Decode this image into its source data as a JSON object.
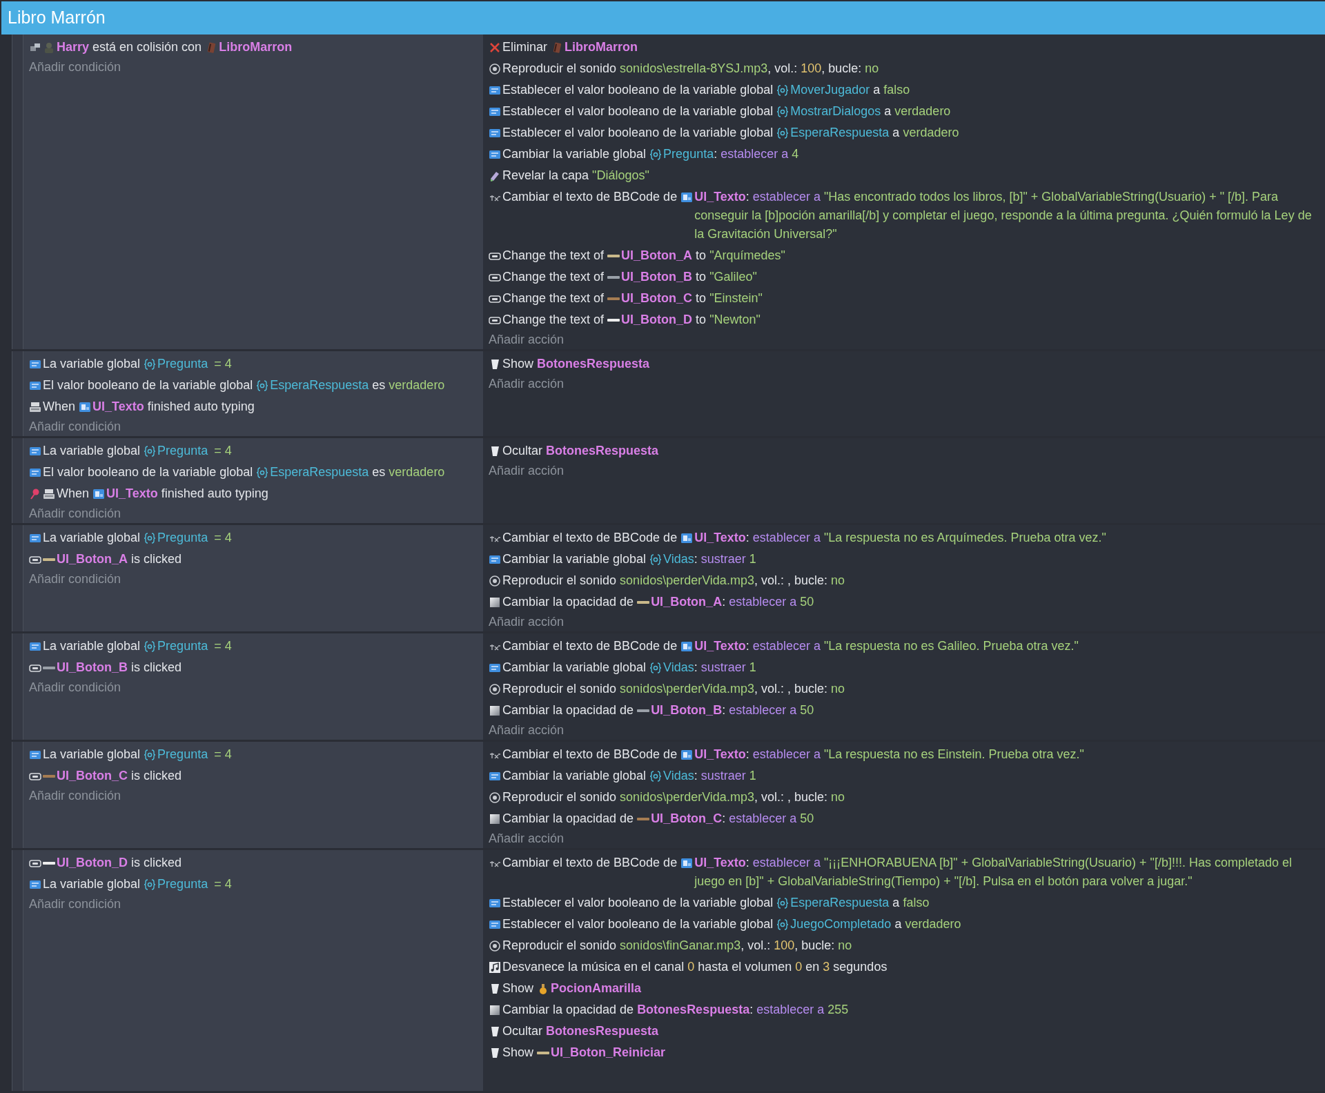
{
  "window": {
    "title": "Libro Marrón"
  },
  "events": [
    {
      "conditions": [
        {
          "parts": [
            {
              "kind": "collision"
            },
            {
              "kind": "character"
            },
            {
              "kind": "object",
              "text": "Harry"
            },
            {
              "kind": "plain",
              "text": " está en colisión con "
            },
            {
              "kind": "book"
            },
            {
              "kind": "object",
              "text": "LibroMarron"
            }
          ]
        }
      ],
      "add_condition": "Añadir condición",
      "actions": [
        {
          "parts": [
            {
              "kind": "delete"
            },
            {
              "kind": "plain",
              "text": "Eliminar "
            },
            {
              "kind": "book"
            },
            {
              "kind": "object",
              "text": "LibroMarron"
            }
          ]
        },
        {
          "parts": [
            {
              "kind": "sound"
            },
            {
              "kind": "plain",
              "text": "Reproducir el sonido "
            },
            {
              "kind": "value",
              "text": "sonidos\\estrella-8YSJ.mp3"
            },
            {
              "kind": "plain",
              "text": ", vol.: "
            },
            {
              "kind": "number",
              "text": "100"
            },
            {
              "kind": "plain",
              "text": ", bucle: "
            },
            {
              "kind": "value",
              "text": "no"
            }
          ]
        },
        {
          "parts": [
            {
              "kind": "variable"
            },
            {
              "kind": "plain",
              "text": "Establecer el valor booleano de la variable global "
            },
            {
              "kind": "globalvar"
            },
            {
              "kind": "varname",
              "text": "MoverJugador"
            },
            {
              "kind": "plain",
              "text": " a "
            },
            {
              "kind": "value",
              "text": "falso"
            }
          ]
        },
        {
          "parts": [
            {
              "kind": "variable"
            },
            {
              "kind": "plain",
              "text": "Establecer el valor booleano de la variable global "
            },
            {
              "kind": "globalvar"
            },
            {
              "kind": "varname",
              "text": "MostrarDialogos"
            },
            {
              "kind": "plain",
              "text": " a "
            },
            {
              "kind": "value",
              "text": "verdadero"
            }
          ]
        },
        {
          "parts": [
            {
              "kind": "variable"
            },
            {
              "kind": "plain",
              "text": "Establecer el valor booleano de la variable global "
            },
            {
              "kind": "globalvar"
            },
            {
              "kind": "varname",
              "text": "EsperaRespuesta"
            },
            {
              "kind": "plain",
              "text": " a "
            },
            {
              "kind": "value",
              "text": "verdadero"
            }
          ]
        },
        {
          "parts": [
            {
              "kind": "variable"
            },
            {
              "kind": "plain",
              "text": "Cambiar la variable global "
            },
            {
              "kind": "globalvar"
            },
            {
              "kind": "varname",
              "text": "Pregunta"
            },
            {
              "kind": "plain",
              "text": ": "
            },
            {
              "kind": "operator",
              "text": "establecer a"
            },
            {
              "kind": "value",
              "text": "4"
            }
          ]
        },
        {
          "parts": [
            {
              "kind": "layer"
            },
            {
              "kind": "plain",
              "text": "Revelar la capa "
            },
            {
              "kind": "value",
              "text": "\"Diálogos\""
            }
          ]
        },
        {
          "parts": [
            {
              "kind": "text"
            },
            {
              "kind": "plain",
              "text": "Cambiar el texto de BBCode de "
            },
            {
              "kind": "bbtext"
            },
            {
              "kind": "object",
              "text": "UI_Texto"
            },
            {
              "kind": "plain",
              "text": ": "
            },
            {
              "kind": "operator",
              "text": "establecer a"
            },
            {
              "kind": "value",
              "text": "\"Has encontrado todos los libros, [b]\" + GlobalVariableString(Usuario) + \" [/b]. Para conseguir la [b]poción amarilla[/b] y completar el juego, responde a la última pregunta. ¿Quién formuló la Ley de la Gravitación Universal?\""
            }
          ]
        },
        {
          "parts": [
            {
              "kind": "button"
            },
            {
              "kind": "plain",
              "text": "Change the text of "
            },
            {
              "kind": "bar",
              "color": "#c9b88a"
            },
            {
              "kind": "object",
              "text": "UI_Boton_A"
            },
            {
              "kind": "plain",
              "text": " to "
            },
            {
              "kind": "value",
              "text": "\"Arquímedes\""
            }
          ]
        },
        {
          "parts": [
            {
              "kind": "button"
            },
            {
              "kind": "plain",
              "text": "Change the text of "
            },
            {
              "kind": "bar",
              "color": "#9aa0a8"
            },
            {
              "kind": "object",
              "text": "UI_Boton_B"
            },
            {
              "kind": "plain",
              "text": " to "
            },
            {
              "kind": "value",
              "text": "\"Galileo\""
            }
          ]
        },
        {
          "parts": [
            {
              "kind": "button"
            },
            {
              "kind": "plain",
              "text": "Change the text of "
            },
            {
              "kind": "bar",
              "color": "#a57c52"
            },
            {
              "kind": "object",
              "text": "UI_Boton_C"
            },
            {
              "kind": "plain",
              "text": " to "
            },
            {
              "kind": "value",
              "text": "\"Einstein\""
            }
          ]
        },
        {
          "parts": [
            {
              "kind": "button"
            },
            {
              "kind": "plain",
              "text": "Change the text of "
            },
            {
              "kind": "bar",
              "color": "#ececec"
            },
            {
              "kind": "object",
              "text": "UI_Boton_D"
            },
            {
              "kind": "plain",
              "text": " to "
            },
            {
              "kind": "value",
              "text": "\"Newton\""
            }
          ]
        }
      ],
      "add_action": "Añadir acción"
    },
    {
      "conditions": [
        {
          "parts": [
            {
              "kind": "variable"
            },
            {
              "kind": "plain",
              "text": "La variable global "
            },
            {
              "kind": "globalvar"
            },
            {
              "kind": "varname",
              "text": "Pregunta"
            },
            {
              "kind": "value",
              "text": "= 4"
            }
          ]
        },
        {
          "parts": [
            {
              "kind": "variable"
            },
            {
              "kind": "plain",
              "text": "El valor booleano de la variable global "
            },
            {
              "kind": "globalvar"
            },
            {
              "kind": "varname",
              "text": "EsperaRespuesta"
            },
            {
              "kind": "plain",
              "text": " es "
            },
            {
              "kind": "value",
              "text": "verdadero"
            }
          ]
        },
        {
          "parts": [
            {
              "kind": "typing"
            },
            {
              "kind": "plain",
              "text": "When "
            },
            {
              "kind": "bbtext"
            },
            {
              "kind": "object",
              "text": "UI_Texto"
            },
            {
              "kind": "plain",
              "text": " finished auto typing"
            }
          ]
        }
      ],
      "add_condition": "Añadir condición",
      "actions": [
        {
          "parts": [
            {
              "kind": "show"
            },
            {
              "kind": "plain",
              "text": "Show "
            },
            {
              "kind": "object",
              "text": "BotonesRespuesta"
            }
          ]
        }
      ],
      "add_action": "Añadir acción"
    },
    {
      "conditions": [
        {
          "parts": [
            {
              "kind": "variable"
            },
            {
              "kind": "plain",
              "text": "La variable global "
            },
            {
              "kind": "globalvar"
            },
            {
              "kind": "varname",
              "text": "Pregunta"
            },
            {
              "kind": "value",
              "text": "= 4"
            }
          ]
        },
        {
          "parts": [
            {
              "kind": "variable"
            },
            {
              "kind": "plain",
              "text": "El valor booleano de la variable global "
            },
            {
              "kind": "globalvar"
            },
            {
              "kind": "varname",
              "text": "EsperaRespuesta"
            },
            {
              "kind": "plain",
              "text": " es "
            },
            {
              "kind": "value",
              "text": "verdadero"
            }
          ]
        },
        {
          "parts": [
            {
              "kind": "pin"
            },
            {
              "kind": "typing"
            },
            {
              "kind": "plain",
              "text": "When "
            },
            {
              "kind": "bbtext"
            },
            {
              "kind": "object",
              "text": "UI_Texto"
            },
            {
              "kind": "plain",
              "text": " finished auto typing"
            }
          ]
        }
      ],
      "add_condition": "Añadir condición",
      "actions": [
        {
          "parts": [
            {
              "kind": "show"
            },
            {
              "kind": "plain",
              "text": "Ocultar "
            },
            {
              "kind": "object",
              "text": "BotonesRespuesta"
            }
          ]
        }
      ],
      "add_action": "Añadir acción"
    },
    {
      "conditions": [
        {
          "parts": [
            {
              "kind": "variable"
            },
            {
              "kind": "plain",
              "text": "La variable global "
            },
            {
              "kind": "globalvar"
            },
            {
              "kind": "varname",
              "text": "Pregunta"
            },
            {
              "kind": "value",
              "text": "= 4"
            }
          ]
        },
        {
          "parts": [
            {
              "kind": "button"
            },
            {
              "kind": "bar",
              "color": "#c9b88a"
            },
            {
              "kind": "object",
              "text": "UI_Boton_A"
            },
            {
              "kind": "plain",
              "text": " is clicked"
            }
          ]
        }
      ],
      "add_condition": "Añadir condición",
      "actions": [
        {
          "parts": [
            {
              "kind": "text"
            },
            {
              "kind": "plain",
              "text": "Cambiar el texto de BBCode de "
            },
            {
              "kind": "bbtext"
            },
            {
              "kind": "object",
              "text": "UI_Texto"
            },
            {
              "kind": "plain",
              "text": ": "
            },
            {
              "kind": "operator",
              "text": "establecer a"
            },
            {
              "kind": "value",
              "text": "\"La respuesta no es Arquímedes. Prueba otra vez.\""
            }
          ]
        },
        {
          "parts": [
            {
              "kind": "variable"
            },
            {
              "kind": "plain",
              "text": "Cambiar la variable global "
            },
            {
              "kind": "globalvar"
            },
            {
              "kind": "varname",
              "text": "Vidas"
            },
            {
              "kind": "plain",
              "text": ": "
            },
            {
              "kind": "operator",
              "text": "sustraer"
            },
            {
              "kind": "value",
              "text": "1"
            }
          ]
        },
        {
          "parts": [
            {
              "kind": "sound"
            },
            {
              "kind": "plain",
              "text": "Reproducir el sonido "
            },
            {
              "kind": "value",
              "text": "sonidos\\perderVida.mp3"
            },
            {
              "kind": "plain",
              "text": ", vol.: , bucle: "
            },
            {
              "kind": "value",
              "text": "no"
            }
          ]
        },
        {
          "parts": [
            {
              "kind": "opacity"
            },
            {
              "kind": "plain",
              "text": "Cambiar la opacidad de "
            },
            {
              "kind": "bar",
              "color": "#c9b88a"
            },
            {
              "kind": "object",
              "text": "UI_Boton_A"
            },
            {
              "kind": "plain",
              "text": ": "
            },
            {
              "kind": "operator",
              "text": "establecer a"
            },
            {
              "kind": "value",
              "text": "50"
            }
          ]
        }
      ],
      "add_action": "Añadir acción"
    },
    {
      "conditions": [
        {
          "parts": [
            {
              "kind": "variable"
            },
            {
              "kind": "plain",
              "text": "La variable global "
            },
            {
              "kind": "globalvar"
            },
            {
              "kind": "varname",
              "text": "Pregunta"
            },
            {
              "kind": "value",
              "text": "= 4"
            }
          ]
        },
        {
          "parts": [
            {
              "kind": "button"
            },
            {
              "kind": "bar",
              "color": "#9aa0a8"
            },
            {
              "kind": "object",
              "text": "UI_Boton_B"
            },
            {
              "kind": "plain",
              "text": " is clicked"
            }
          ]
        }
      ],
      "add_condition": "Añadir condición",
      "actions": [
        {
          "parts": [
            {
              "kind": "text"
            },
            {
              "kind": "plain",
              "text": "Cambiar el texto de BBCode de "
            },
            {
              "kind": "bbtext"
            },
            {
              "kind": "object",
              "text": "UI_Texto"
            },
            {
              "kind": "plain",
              "text": ": "
            },
            {
              "kind": "operator",
              "text": "establecer a"
            },
            {
              "kind": "value",
              "text": "\"La respuesta no es Galileo. Prueba otra vez.\""
            }
          ]
        },
        {
          "parts": [
            {
              "kind": "variable"
            },
            {
              "kind": "plain",
              "text": "Cambiar la variable global "
            },
            {
              "kind": "globalvar"
            },
            {
              "kind": "varname",
              "text": "Vidas"
            },
            {
              "kind": "plain",
              "text": ": "
            },
            {
              "kind": "operator",
              "text": "sustraer"
            },
            {
              "kind": "value",
              "text": "1"
            }
          ]
        },
        {
          "parts": [
            {
              "kind": "sound"
            },
            {
              "kind": "plain",
              "text": "Reproducir el sonido "
            },
            {
              "kind": "value",
              "text": "sonidos\\perderVida.mp3"
            },
            {
              "kind": "plain",
              "text": ", vol.: , bucle: "
            },
            {
              "kind": "value",
              "text": "no"
            }
          ]
        },
        {
          "parts": [
            {
              "kind": "opacity"
            },
            {
              "kind": "plain",
              "text": "Cambiar la opacidad de "
            },
            {
              "kind": "bar",
              "color": "#9aa0a8"
            },
            {
              "kind": "object",
              "text": "UI_Boton_B"
            },
            {
              "kind": "plain",
              "text": ": "
            },
            {
              "kind": "operator",
              "text": "establecer a"
            },
            {
              "kind": "value",
              "text": "50"
            }
          ]
        }
      ],
      "add_action": "Añadir acción"
    },
    {
      "conditions": [
        {
          "parts": [
            {
              "kind": "variable"
            },
            {
              "kind": "plain",
              "text": "La variable global "
            },
            {
              "kind": "globalvar"
            },
            {
              "kind": "varname",
              "text": "Pregunta"
            },
            {
              "kind": "value",
              "text": "= 4"
            }
          ]
        },
        {
          "parts": [
            {
              "kind": "button"
            },
            {
              "kind": "bar",
              "color": "#a57c52"
            },
            {
              "kind": "object",
              "text": "UI_Boton_C"
            },
            {
              "kind": "plain",
              "text": " is clicked"
            }
          ]
        }
      ],
      "add_condition": "Añadir condición",
      "actions": [
        {
          "parts": [
            {
              "kind": "text"
            },
            {
              "kind": "plain",
              "text": "Cambiar el texto de BBCode de "
            },
            {
              "kind": "bbtext"
            },
            {
              "kind": "object",
              "text": "UI_Texto"
            },
            {
              "kind": "plain",
              "text": ": "
            },
            {
              "kind": "operator",
              "text": "establecer a"
            },
            {
              "kind": "value",
              "text": "\"La respuesta no es Einstein. Prueba otra vez.\""
            }
          ]
        },
        {
          "parts": [
            {
              "kind": "variable"
            },
            {
              "kind": "plain",
              "text": "Cambiar la variable global "
            },
            {
              "kind": "globalvar"
            },
            {
              "kind": "varname",
              "text": "Vidas"
            },
            {
              "kind": "plain",
              "text": ": "
            },
            {
              "kind": "operator",
              "text": "sustraer"
            },
            {
              "kind": "value",
              "text": "1"
            }
          ]
        },
        {
          "parts": [
            {
              "kind": "sound"
            },
            {
              "kind": "plain",
              "text": "Reproducir el sonido "
            },
            {
              "kind": "value",
              "text": "sonidos\\perderVida.mp3"
            },
            {
              "kind": "plain",
              "text": ", vol.: , bucle: "
            },
            {
              "kind": "value",
              "text": "no"
            }
          ]
        },
        {
          "parts": [
            {
              "kind": "opacity"
            },
            {
              "kind": "plain",
              "text": "Cambiar la opacidad de "
            },
            {
              "kind": "bar",
              "color": "#a57c52"
            },
            {
              "kind": "object",
              "text": "UI_Boton_C"
            },
            {
              "kind": "plain",
              "text": ": "
            },
            {
              "kind": "operator",
              "text": "establecer a"
            },
            {
              "kind": "value",
              "text": "50"
            }
          ]
        }
      ],
      "add_action": "Añadir acción"
    },
    {
      "conditions": [
        {
          "parts": [
            {
              "kind": "button"
            },
            {
              "kind": "bar",
              "color": "#ececec"
            },
            {
              "kind": "object",
              "text": "UI_Boton_D"
            },
            {
              "kind": "plain",
              "text": " is clicked"
            }
          ]
        },
        {
          "parts": [
            {
              "kind": "variable"
            },
            {
              "kind": "plain",
              "text": "La variable global "
            },
            {
              "kind": "globalvar"
            },
            {
              "kind": "varname",
              "text": "Pregunta"
            },
            {
              "kind": "value",
              "text": "= 4"
            }
          ]
        }
      ],
      "add_condition": "Añadir condición",
      "actions": [
        {
          "parts": [
            {
              "kind": "text"
            },
            {
              "kind": "plain",
              "text": "Cambiar el texto de BBCode de "
            },
            {
              "kind": "bbtext"
            },
            {
              "kind": "object",
              "text": "UI_Texto"
            },
            {
              "kind": "plain",
              "text": ": "
            },
            {
              "kind": "operator",
              "text": "establecer a"
            },
            {
              "kind": "value",
              "text": "\"¡¡¡ENHORABUENA [b]\" + GlobalVariableString(Usuario) + \"[/b]!!!. Has completado el juego en [b]\" + GlobalVariableString(Tiempo) + \"[/b]. Pulsa en el botón para volver a jugar.\""
            }
          ]
        },
        {
          "parts": [
            {
              "kind": "variable"
            },
            {
              "kind": "plain",
              "text": "Establecer el valor booleano de la variable global "
            },
            {
              "kind": "globalvar"
            },
            {
              "kind": "varname",
              "text": "EsperaRespuesta"
            },
            {
              "kind": "plain",
              "text": " a "
            },
            {
              "kind": "value",
              "text": "falso"
            }
          ]
        },
        {
          "parts": [
            {
              "kind": "variable"
            },
            {
              "kind": "plain",
              "text": "Establecer el valor booleano de la variable global "
            },
            {
              "kind": "globalvar"
            },
            {
              "kind": "varname",
              "text": "JuegoCompletado"
            },
            {
              "kind": "plain",
              "text": " a "
            },
            {
              "kind": "value",
              "text": "verdadero"
            }
          ]
        },
        {
          "parts": [
            {
              "kind": "sound"
            },
            {
              "kind": "plain",
              "text": "Reproducir el sonido "
            },
            {
              "kind": "value",
              "text": "sonidos\\finGanar.mp3"
            },
            {
              "kind": "plain",
              "text": ", vol.: "
            },
            {
              "kind": "number",
              "text": "100"
            },
            {
              "kind": "plain",
              "text": ", bucle: "
            },
            {
              "kind": "value",
              "text": "no"
            }
          ]
        },
        {
          "parts": [
            {
              "kind": "music"
            },
            {
              "kind": "plain",
              "text": "Desvanece la música en el canal "
            },
            {
              "kind": "number",
              "text": "0"
            },
            {
              "kind": "plain",
              "text": " hasta el volumen "
            },
            {
              "kind": "number",
              "text": "0"
            },
            {
              "kind": "plain",
              "text": " en "
            },
            {
              "kind": "number",
              "text": "3"
            },
            {
              "kind": "plain",
              "text": " segundos"
            }
          ]
        },
        {
          "parts": [
            {
              "kind": "show"
            },
            {
              "kind": "plain",
              "text": "Show "
            },
            {
              "kind": "potion"
            },
            {
              "kind": "object",
              "text": "PocionAmarilla"
            }
          ]
        },
        {
          "parts": [
            {
              "kind": "opacity"
            },
            {
              "kind": "plain",
              "text": "Cambiar la opacidad de "
            },
            {
              "kind": "object",
              "text": "BotonesRespuesta"
            },
            {
              "kind": "plain",
              "text": ": "
            },
            {
              "kind": "operator",
              "text": "establecer a"
            },
            {
              "kind": "value",
              "text": "255"
            }
          ]
        },
        {
          "parts": [
            {
              "kind": "show"
            },
            {
              "kind": "plain",
              "text": "Ocultar "
            },
            {
              "kind": "object",
              "text": "BotonesRespuesta"
            }
          ]
        },
        {
          "parts": [
            {
              "kind": "show"
            },
            {
              "kind": "plain",
              "text": "Show "
            },
            {
              "kind": "bar",
              "color": "#c9b88a"
            },
            {
              "kind": "object",
              "text": "UI_Boton_Reiniciar"
            }
          ]
        }
      ]
    }
  ]
}
